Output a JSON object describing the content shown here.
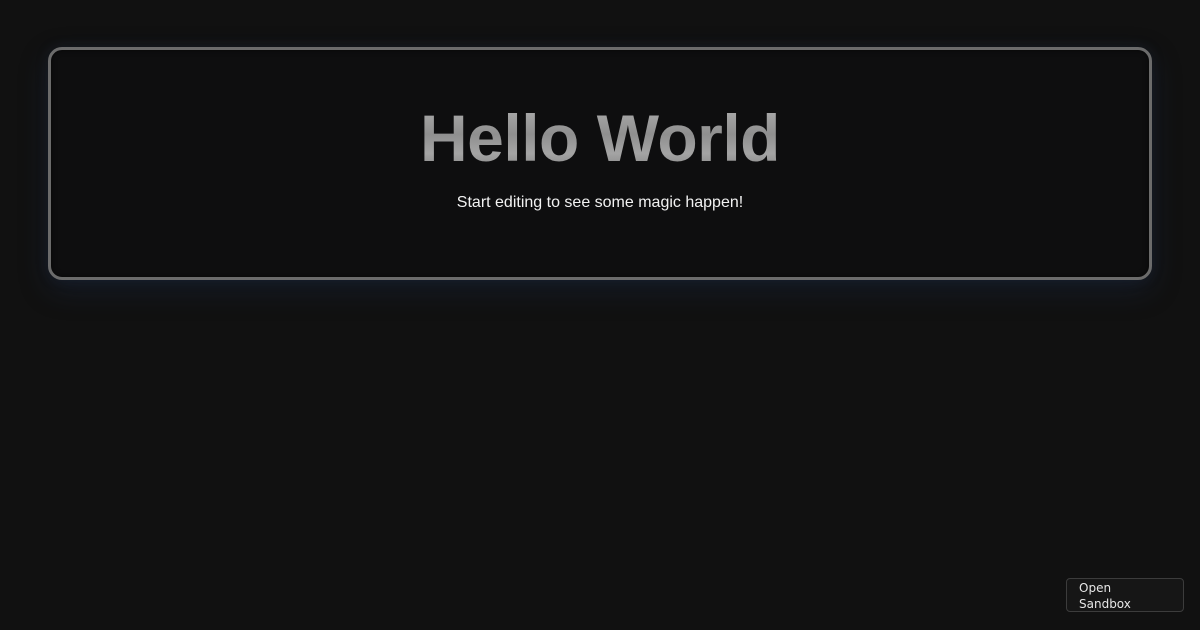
{
  "hero": {
    "title": "Hello World",
    "subtitle": "Start editing to see some magic happen!"
  },
  "footer": {
    "open_sandbox_label": "Open Sandbox"
  },
  "colors": {
    "background": "#111111",
    "card_border": "#6b6b6b",
    "title": "#9a9a9a",
    "subtitle": "#f2f2f2"
  }
}
